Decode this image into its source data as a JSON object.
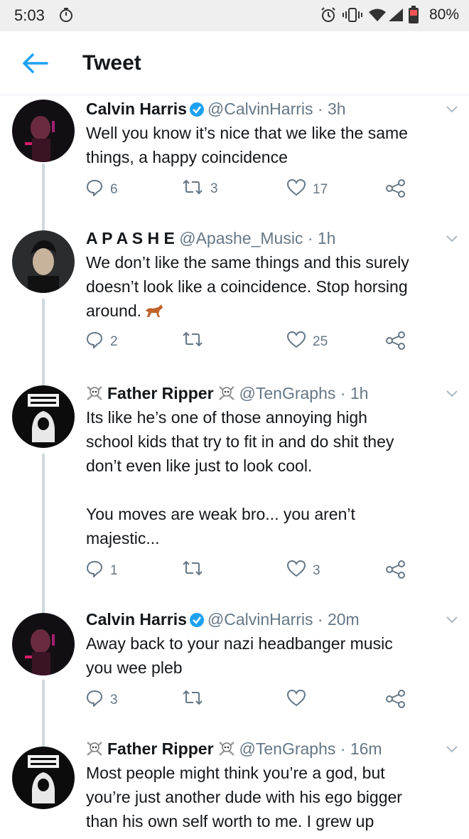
{
  "status_bar": {
    "time": "5:03",
    "battery": "80%"
  },
  "header": {
    "title": "Tweet"
  },
  "tweets": [
    {
      "name": "Calvin Harris",
      "handle": "@CalvinHarris",
      "age": "3h",
      "text": "Well you know it’s nice that we like the same\nthings, a happy coincidence",
      "replies": "6",
      "retweets": "3",
      "likes": "17"
    },
    {
      "name": "A P A S H E",
      "handle": "@Apashe_Music",
      "age": "1h",
      "text": "We don’t like the same things and this surely\ndoesn’t look like a coincidence. Stop horsing\naround.",
      "replies": "2",
      "retweets": "",
      "likes": "25"
    },
    {
      "name": "Father Ripper",
      "handle": "@TenGraphs",
      "age": "1h",
      "text": "Its like he’s one of those annoying high\nschool kids that try to fit in and do shit they\ndon’t even like just to look cool.\n\nYou moves are weak bro... you aren’t\nmajestic...",
      "replies": "1",
      "retweets": "",
      "likes": "3"
    },
    {
      "name": "Calvin Harris",
      "handle": "@CalvinHarris",
      "age": "20m",
      "text": "Away back to your nazi headbanger music\nyou wee pleb",
      "replies": "3",
      "retweets": "",
      "likes": ""
    },
    {
      "name": "Father Ripper",
      "handle": "@TenGraphs",
      "age": "16m",
      "text": "Most people might think you’re a god, but\nyou’re just another dude with his ego bigger\nthan his own self worth to me. I grew up",
      "replies": "",
      "retweets": "",
      "likes": ""
    }
  ]
}
